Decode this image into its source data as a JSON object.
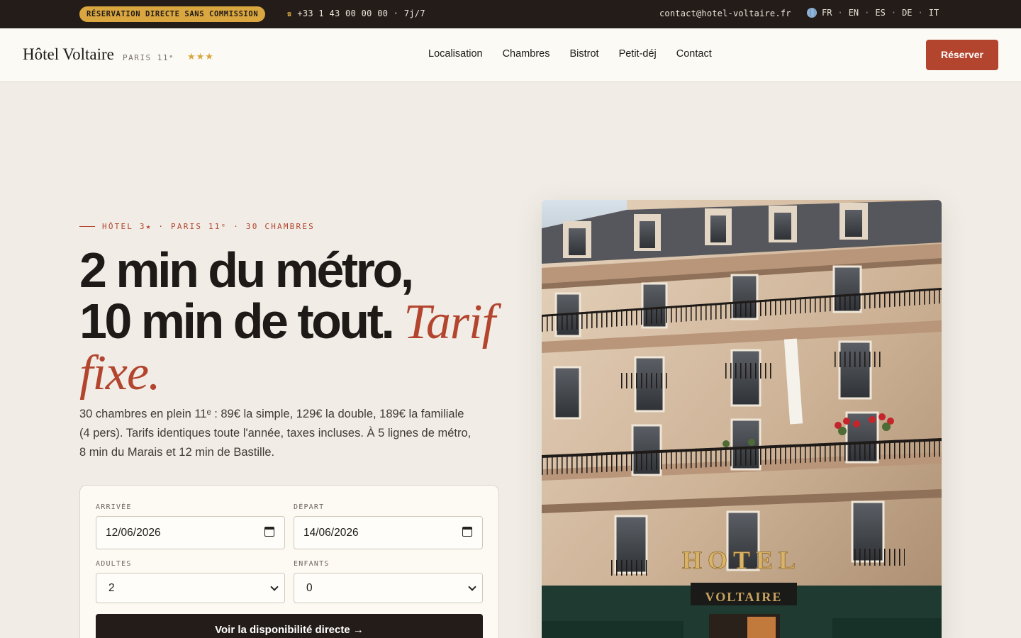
{
  "topbar": {
    "badge": "RÉSERVATION DIRECTE SANS COMMISSION",
    "phone_icon": "phone-icon",
    "phone": "+33 1 43 00 00 00 · 7j/7",
    "email": "contact@hotel-voltaire.fr",
    "globe_icon": "globe-icon",
    "languages": [
      "FR",
      "EN",
      "ES",
      "DE",
      "IT"
    ]
  },
  "header": {
    "logo": "Hôtel Voltaire",
    "logo_sub": "PARIS 11ᵉ",
    "stars": "★★★",
    "nav": [
      "Localisation",
      "Chambres",
      "Bistrot",
      "Petit-déj",
      "Contact"
    ],
    "reserve_label": "Réserver"
  },
  "hero": {
    "eyebrow": "HÔTEL 3★ · PARIS 11ᵉ · 30 CHAMBRES",
    "headline_line1": "2 min du métro,",
    "headline_line2": "10 min de tout.",
    "headline_accent_1": "Tarif",
    "headline_accent_2": "fixe.",
    "description": "30 chambres en plein 11ᵉ : 89€ la simple, 129€ la double, 189€ la familiale (4 pers). Tarifs identiques toute l'année, taxes incluses. À 5 lignes de métro, 8 min du Marais et 12 min de Bastille."
  },
  "booking": {
    "arrival_label": "ARRIVÉE",
    "arrival_value": "12/06/2026",
    "departure_label": "DÉPART",
    "departure_value": "14/06/2026",
    "adults_label": "ADULTES",
    "adults_value": "2",
    "children_label": "ENFANTS",
    "children_value": "0",
    "cta": "Voir la disponibilité directe →"
  },
  "image": {
    "sign_top": "HOTEL",
    "sign_bottom": "VOLTAIRE"
  },
  "colors": {
    "accent": "#b3452f",
    "gold": "#d9a63f",
    "dark": "#231c19",
    "background": "#f1ede6"
  }
}
